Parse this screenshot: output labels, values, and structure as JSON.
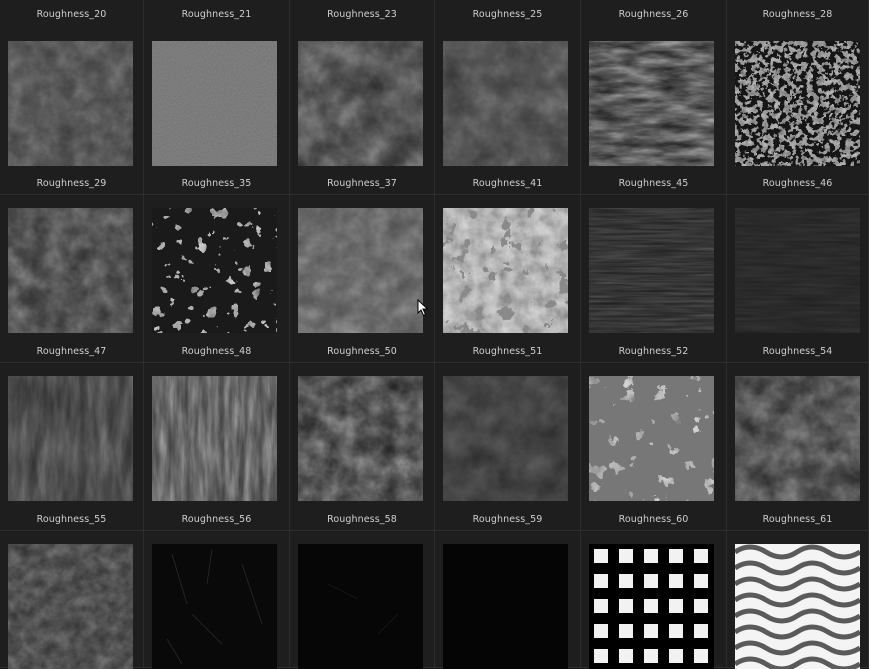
{
  "textures": [
    {
      "label": "Roughness_20"
    },
    {
      "label": "Roughness_21"
    },
    {
      "label": "Roughness_23"
    },
    {
      "label": "Roughness_25"
    },
    {
      "label": "Roughness_26"
    },
    {
      "label": "Roughness_28"
    },
    {
      "label": "Roughness_29"
    },
    {
      "label": "Roughness_35"
    },
    {
      "label": "Roughness_37"
    },
    {
      "label": "Roughness_41"
    },
    {
      "label": "Roughness_45"
    },
    {
      "label": "Roughness_46"
    },
    {
      "label": "Roughness_47"
    },
    {
      "label": "Roughness_48"
    },
    {
      "label": "Roughness_50"
    },
    {
      "label": "Roughness_51"
    },
    {
      "label": "Roughness_52"
    },
    {
      "label": "Roughness_54"
    },
    {
      "label": "Roughness_55"
    },
    {
      "label": "Roughness_56"
    },
    {
      "label": "Roughness_58"
    },
    {
      "label": "Roughness_59"
    },
    {
      "label": "Roughness_60"
    },
    {
      "label": "Roughness_61"
    }
  ]
}
